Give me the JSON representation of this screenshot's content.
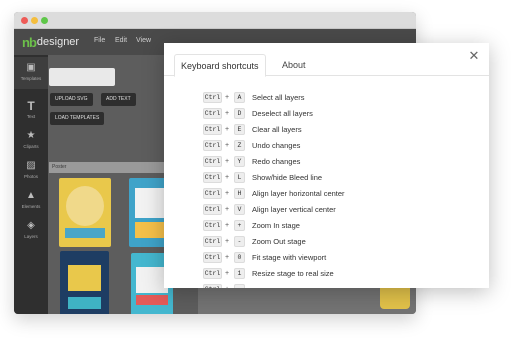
{
  "app": {
    "logo_mark": "nb",
    "logo_text": "designer"
  },
  "menu": [
    "File",
    "Edit",
    "View"
  ],
  "sidebar": [
    "Templates",
    "Text",
    "Cliparts",
    "Photos",
    "Elements",
    "Layers"
  ],
  "panel": {
    "upload_svg": "UPLOAD SVG",
    "add_text": "ADD TEXT",
    "load_templates": "LOAD TEMPLATES",
    "category": "Poster"
  },
  "dialog": {
    "tabs": [
      "Keyboard shortcuts",
      "About"
    ],
    "modifier": "Ctrl",
    "plus": "+",
    "shortcuts": [
      {
        "key": "A",
        "desc": "Select all layers"
      },
      {
        "key": "D",
        "desc": "Deselect all layers"
      },
      {
        "key": "E",
        "desc": "Clear all layers"
      },
      {
        "key": "Z",
        "desc": "Undo changes"
      },
      {
        "key": "Y",
        "desc": "Redo changes"
      },
      {
        "key": "L",
        "desc": "Show/hide Bleed line"
      },
      {
        "key": "H",
        "desc": "Align layer horizontal center"
      },
      {
        "key": "V",
        "desc": "Align layer vertical center"
      },
      {
        "key": "+",
        "desc": "Zoom In stage"
      },
      {
        "key": "-",
        "desc": "Zoom Out stage"
      },
      {
        "key": "0",
        "desc": "Fit stage with viewport"
      },
      {
        "key": "1",
        "desc": "Resize stage to real size"
      },
      {
        "key": "",
        "desc": ""
      }
    ]
  }
}
